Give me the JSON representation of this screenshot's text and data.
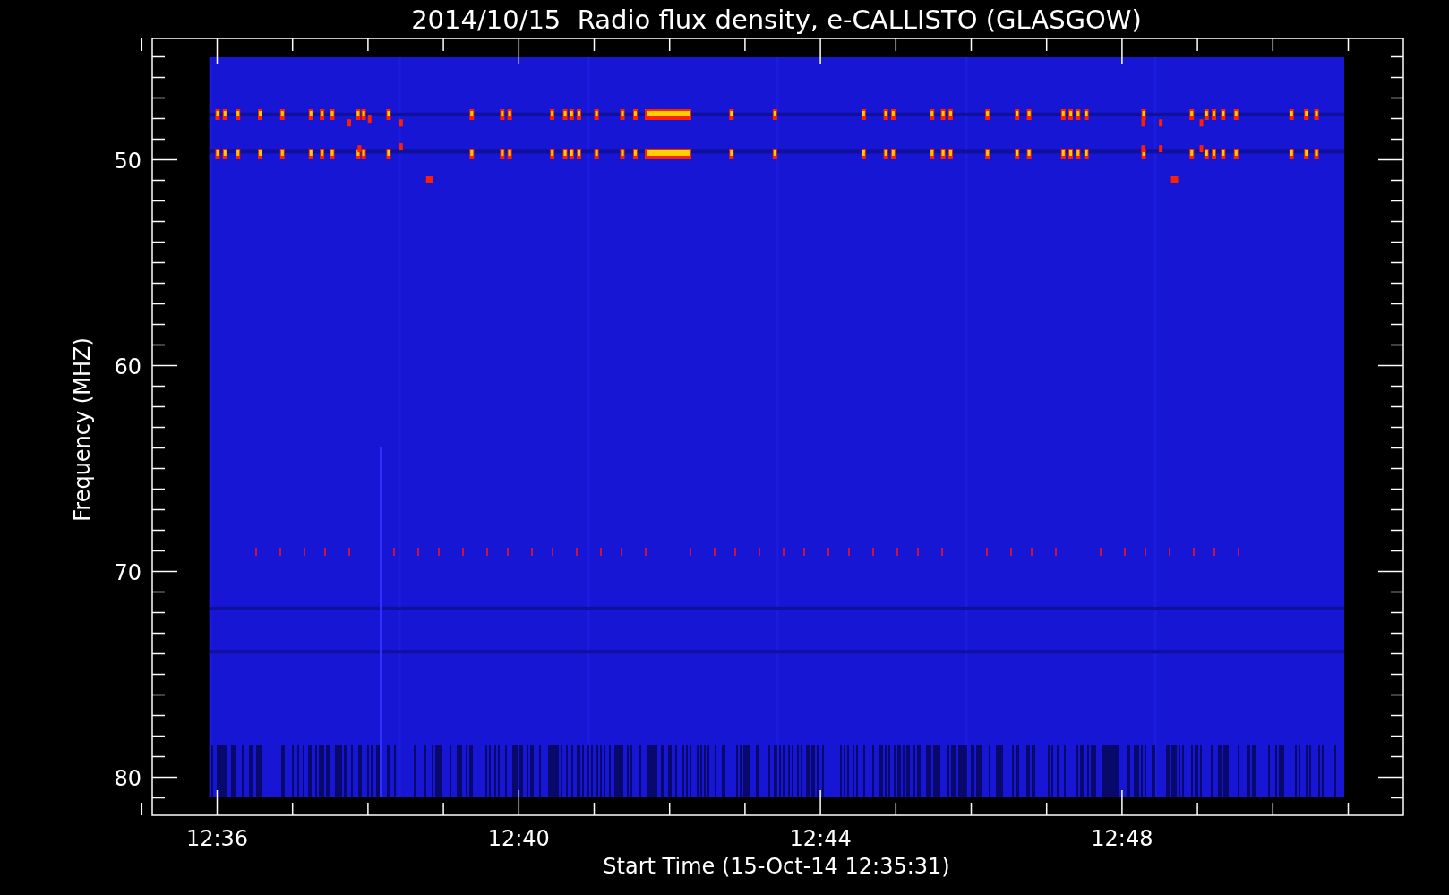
{
  "title": "2014/10/15  Radio flux density, e-CALLISTO (GLASGOW)",
  "y_axis": {
    "label": "Frequency (MHZ)",
    "ticks": [
      "50",
      "60",
      "70",
      "80"
    ]
  },
  "x_axis": {
    "label": "Start Time (15-Oct-14 12:35:31)",
    "ticks": [
      "12:36",
      "12:40",
      "12:44",
      "12:48"
    ]
  }
}
